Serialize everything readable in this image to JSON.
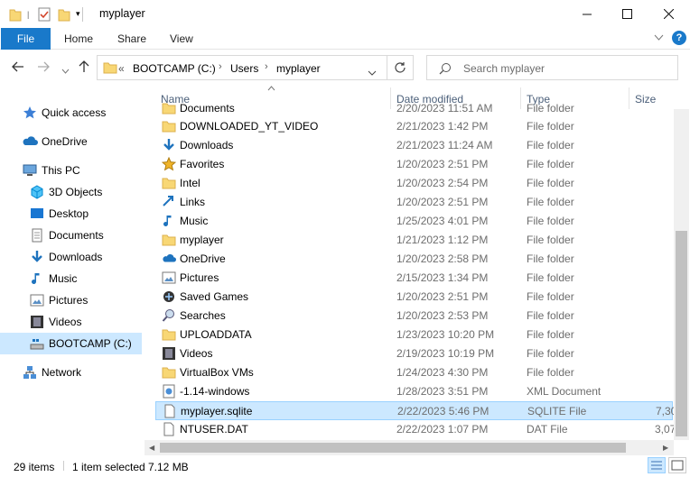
{
  "window": {
    "title": "myplayer",
    "controls": [
      "minimize",
      "maximize",
      "close"
    ]
  },
  "ribbon": {
    "tabs": [
      {
        "label": "File",
        "active": true
      },
      {
        "label": "Home"
      },
      {
        "label": "Share"
      },
      {
        "label": "View"
      }
    ],
    "colors": {
      "file_tab": "#1979ca",
      "selection": "#cce8ff"
    }
  },
  "address": {
    "overflow": "«",
    "crumbs": [
      "BOOTCAMP (C:)",
      "Users",
      "myplayer"
    ]
  },
  "search": {
    "placeholder": "Search myplayer"
  },
  "nav_pane": {
    "items": [
      {
        "label": "Quick access",
        "icon": "star-icon"
      },
      {
        "label": "OneDrive",
        "icon": "cloud-icon"
      },
      {
        "label": "This PC",
        "icon": "computer-icon"
      },
      {
        "label": "3D Objects",
        "icon": "cube-icon"
      },
      {
        "label": "Desktop",
        "icon": "desktop-icon"
      },
      {
        "label": "Documents",
        "icon": "document-icon"
      },
      {
        "label": "Downloads",
        "icon": "download-icon"
      },
      {
        "label": "Music",
        "icon": "music-icon"
      },
      {
        "label": "Pictures",
        "icon": "picture-icon"
      },
      {
        "label": "Videos",
        "icon": "video-icon"
      },
      {
        "label": "BOOTCAMP (C:)",
        "icon": "drive-icon",
        "selected": true
      },
      {
        "label": "Network",
        "icon": "network-icon"
      }
    ]
  },
  "columns": [
    "Name",
    "Date modified",
    "Type",
    "Size"
  ],
  "files": [
    {
      "name": "Documents",
      "date": "2/20/2023 11:51 AM",
      "type": "File folder",
      "size": "",
      "icon": "folder-icon"
    },
    {
      "name": "DOWNLOADED_YT_VIDEO",
      "date": "2/21/2023 1:42 PM",
      "type": "File folder",
      "size": "",
      "icon": "folder-icon"
    },
    {
      "name": "Downloads",
      "date": "2/21/2023 11:24 AM",
      "type": "File folder",
      "size": "",
      "icon": "download-icon"
    },
    {
      "name": "Favorites",
      "date": "1/20/2023 2:51 PM",
      "type": "File folder",
      "size": "",
      "icon": "star-icon"
    },
    {
      "name": "Intel",
      "date": "1/20/2023 2:54 PM",
      "type": "File folder",
      "size": "",
      "icon": "folder-icon"
    },
    {
      "name": "Links",
      "date": "1/20/2023 2:51 PM",
      "type": "File folder",
      "size": "",
      "icon": "link-icon"
    },
    {
      "name": "Music",
      "date": "1/25/2023 4:01 PM",
      "type": "File folder",
      "size": "",
      "icon": "music-icon"
    },
    {
      "name": "myplayer",
      "date": "1/21/2023 1:12 PM",
      "type": "File folder",
      "size": "",
      "icon": "folder-icon"
    },
    {
      "name": "OneDrive",
      "date": "1/20/2023 2:58 PM",
      "type": "File folder",
      "size": "",
      "icon": "cloud-icon"
    },
    {
      "name": "Pictures",
      "date": "2/15/2023 1:34 PM",
      "type": "File folder",
      "size": "",
      "icon": "picture-icon"
    },
    {
      "name": "Saved Games",
      "date": "1/20/2023 2:51 PM",
      "type": "File folder",
      "size": "",
      "icon": "gamepad-icon"
    },
    {
      "name": "Searches",
      "date": "1/20/2023 2:53 PM",
      "type": "File folder",
      "size": "",
      "icon": "magnifier-icon"
    },
    {
      "name": "UPLOADDATA",
      "date": "1/23/2023 10:20 PM",
      "type": "File folder",
      "size": "",
      "icon": "folder-icon"
    },
    {
      "name": "Videos",
      "date": "2/19/2023 10:19 PM",
      "type": "File folder",
      "size": "",
      "icon": "video-icon"
    },
    {
      "name": "VirtualBox VMs",
      "date": "1/24/2023 4:30 PM",
      "type": "File folder",
      "size": "",
      "icon": "folder-icon"
    },
    {
      "name": "-1.14-windows",
      "date": "1/28/2023 3:51 PM",
      "type": "XML Document",
      "size": "",
      "icon": "xml-icon"
    },
    {
      "name": "myplayer.sqlite",
      "date": "2/22/2023 5:46 PM",
      "type": "SQLITE File",
      "size": "7,30",
      "icon": "file-icon",
      "selected": true
    },
    {
      "name": "NTUSER.DAT",
      "date": "2/22/2023 1:07 PM",
      "type": "DAT File",
      "size": "3,07",
      "icon": "file-icon"
    }
  ],
  "status": {
    "items": "29 items",
    "selected": "1 item selected",
    "size": "7.12 MB"
  }
}
